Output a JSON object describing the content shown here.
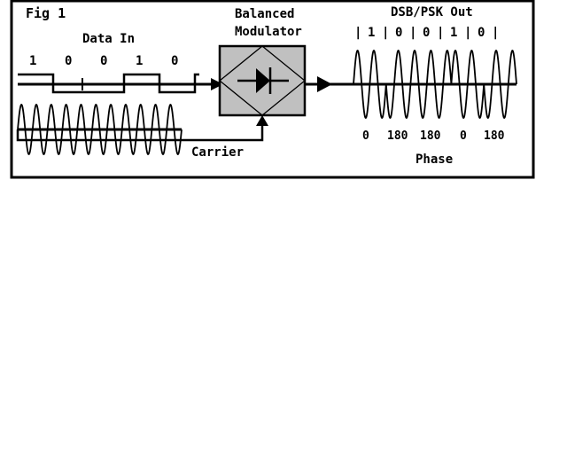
{
  "figure": {
    "label": "Fig 1",
    "frame_color": "#000000",
    "background": "#ffffff"
  },
  "data_in": {
    "title": "Data In",
    "bits": [
      "1",
      "0",
      "0",
      "1",
      "0"
    ],
    "levels": [
      1,
      0,
      0,
      1,
      0
    ]
  },
  "carrier": {
    "label": "Carrier",
    "cycles": 11
  },
  "modulator": {
    "title_line1": "Balanced",
    "title_line2": "Modulator",
    "fill_color": "#c0c0c0",
    "symbol": "diode"
  },
  "output": {
    "title": "DSB/PSK Out",
    "bits": [
      "1",
      "0",
      "0",
      "1",
      "0"
    ],
    "separator": "|",
    "phases": [
      "0",
      "180",
      "180",
      "0",
      "180"
    ],
    "phase_caption": "Phase",
    "cycles_per_bit": 2
  },
  "icons": {
    "input_arrow": "arrow-right-icon",
    "output_arrow": "arrow-right-icon",
    "carrier_arrow": "arrow-up-icon",
    "diode": "diode-icon"
  }
}
